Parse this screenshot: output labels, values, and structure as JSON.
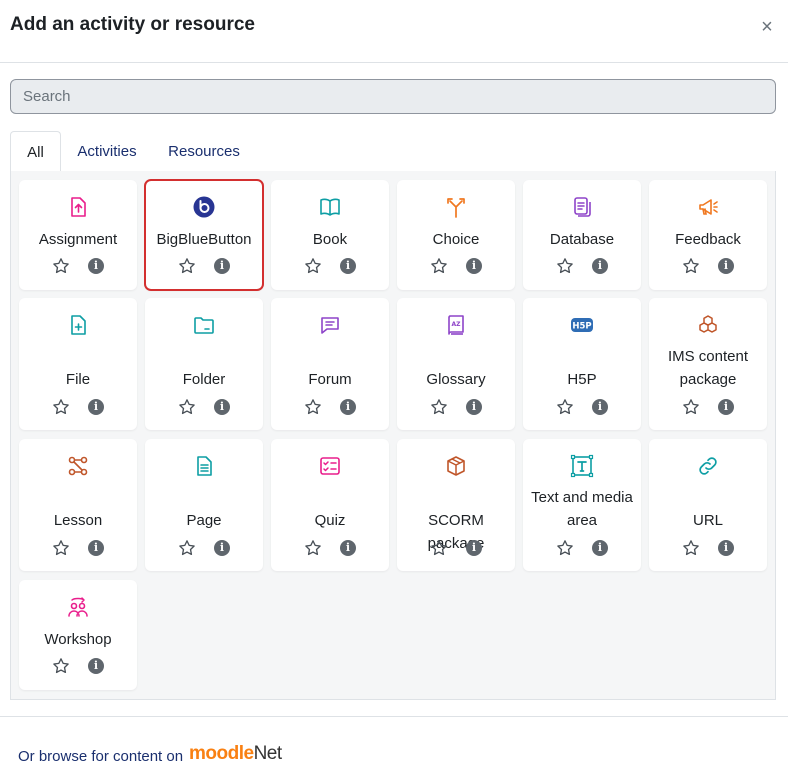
{
  "dialog": {
    "title": "Add an activity or resource",
    "close_symbol": "×"
  },
  "search": {
    "placeholder": "Search"
  },
  "tabs": [
    {
      "label": "All",
      "active": true
    },
    {
      "label": "Activities",
      "active": false
    },
    {
      "label": "Resources",
      "active": false
    }
  ],
  "items": [
    {
      "label": "Assignment",
      "icon": "assignment-icon",
      "color": "#e91e8c"
    },
    {
      "label": "BigBlueButton",
      "icon": "bigbluebutton-icon",
      "color": "#283593",
      "selected": true
    },
    {
      "label": "Book",
      "icon": "book-icon",
      "color": "#0d9ea4"
    },
    {
      "label": "Choice",
      "icon": "choice-icon",
      "color": "#f07820"
    },
    {
      "label": "Database",
      "icon": "database-icon",
      "color": "#8e44c9"
    },
    {
      "label": "Feedback",
      "icon": "feedback-icon",
      "color": "#f07820"
    },
    {
      "label": "File",
      "icon": "file-icon",
      "color": "#0d9ea4"
    },
    {
      "label": "Folder",
      "icon": "folder-icon",
      "color": "#0d9ea4"
    },
    {
      "label": "Forum",
      "icon": "forum-icon",
      "color": "#8e44c9"
    },
    {
      "label": "Glossary",
      "icon": "glossary-icon",
      "color": "#8e44c9"
    },
    {
      "label": "H5P",
      "icon": "h5p-icon",
      "color": "#2f6db5"
    },
    {
      "label": "IMS content package",
      "icon": "ims-package-icon",
      "color": "#c0562a"
    },
    {
      "label": "Lesson",
      "icon": "lesson-icon",
      "color": "#c0562a"
    },
    {
      "label": "Page",
      "icon": "page-icon",
      "color": "#0d9ea4"
    },
    {
      "label": "Quiz",
      "icon": "quiz-icon",
      "color": "#e91e8c"
    },
    {
      "label": "SCORM package",
      "icon": "scorm-icon",
      "color": "#c0562a"
    },
    {
      "label": "Text and media area",
      "icon": "text-media-icon",
      "color": "#0d9ea4"
    },
    {
      "label": "URL",
      "icon": "url-icon",
      "color": "#0d9ea4"
    },
    {
      "label": "Workshop",
      "icon": "workshop-icon",
      "color": "#e91e8c"
    }
  ],
  "info_symbol": "i",
  "footer": {
    "browse_text": "Or browse for content on",
    "moodlenet_part1": "moodle",
    "moodlenet_part2": "Net"
  },
  "colors": {
    "accent": "#0f47ad",
    "selected_outline": "#d32f2f"
  }
}
